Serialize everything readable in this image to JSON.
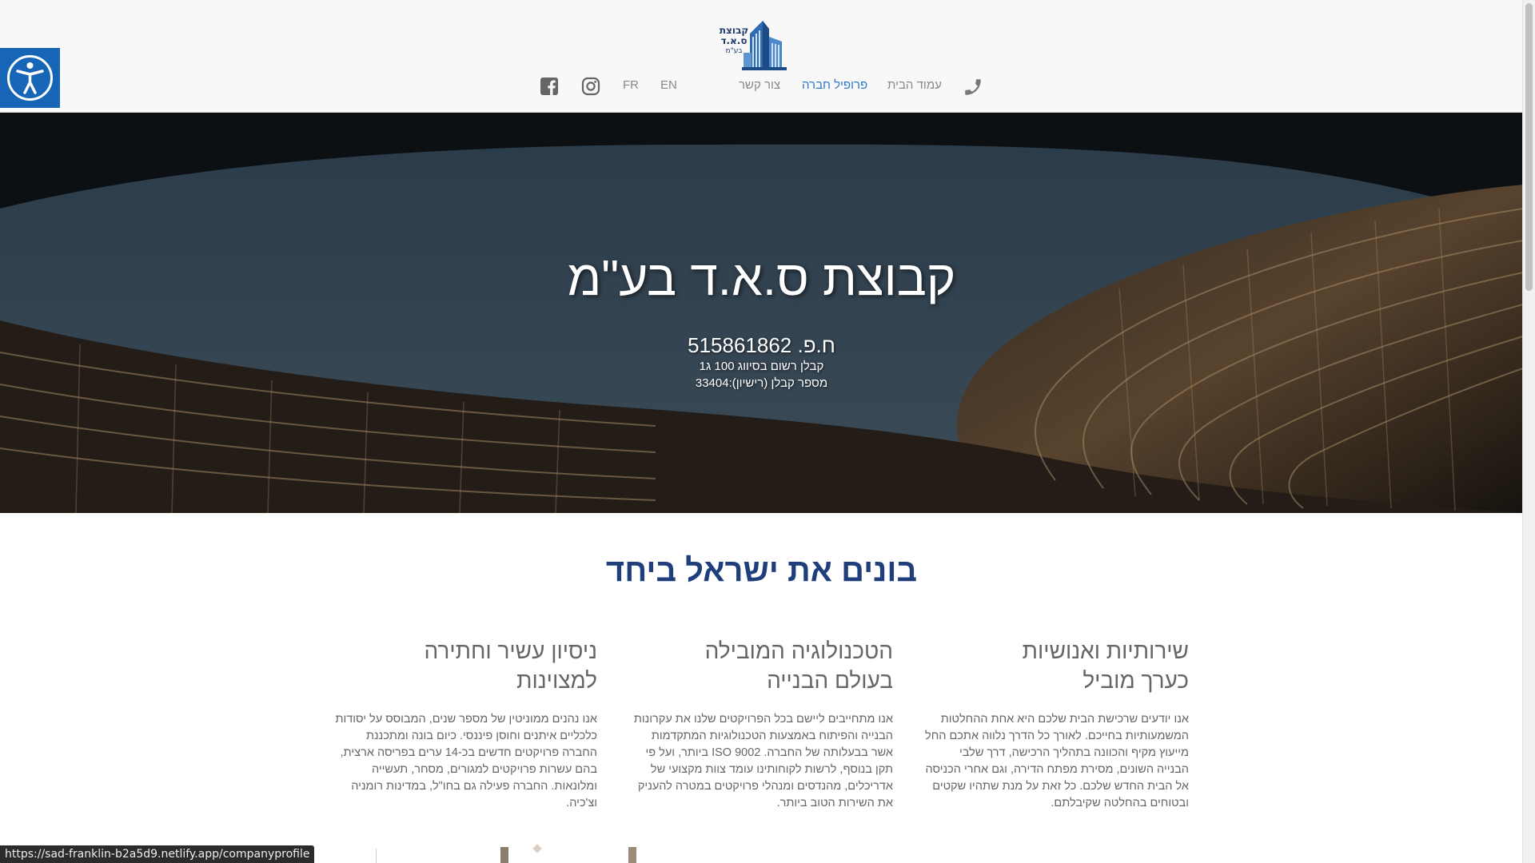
{
  "logo": {
    "text_lines": [
      "קבוצת",
      "ס.א.ד",
      "בע\"מ"
    ]
  },
  "nav": {
    "items": [
      {
        "label": "עמוד הבית",
        "active": false
      },
      {
        "label": "פרופיל חברה",
        "active": true
      },
      {
        "label": "צור קשר",
        "active": false
      }
    ],
    "languages": [
      "EN",
      "FR"
    ],
    "icons": [
      "phone-icon",
      "instagram-icon",
      "facebook-icon"
    ]
  },
  "accessibility": {
    "icon": "accessibility-icon",
    "color": "#1665b6"
  },
  "hero": {
    "title": "קבוצת ס.א.ד בע\"מ",
    "company_id": "ח.פ. 515861862",
    "contractor_class": "קבלן רשום בסיווג 100 ג1",
    "license": "מספר קבלן (רישיון):33404"
  },
  "section": {
    "title": "בונים את ישראל ביחד",
    "columns": [
      {
        "heading": "שירותיות ואנושיות\nכערך מוביל",
        "body": "אנו יודעים שרכישת הבית שלכם היא אחת ההחלטות המשמעותיות בחייכם. לאורך כל הדרך נלווה אתכם החל מייעוץ מקיף והכוונה בתהליך הרכישה, דרך שלבי הבנייה השונים, מסירת מפתח הדירה, וגם אחרי הכניסה אל הבית החדש שלכם. כל זאת על מנת שתהיו שקטים ובטוחים בהחלטה שקיבלתם."
      },
      {
        "heading": "הטכנולוגיה המובילה\nבעולם הבנייה",
        "body": "אנו מתחייבים ליישם בכל הפרויקטים שלנו את עקרונות הבנייה והפיתוח באמצעות הטכנולוגיות המתקדמות אשר בבעלותה של החברה. ISO 9002 ביותר, ועל פי תקן בנוסף, לרשות לקוחותינו עומד צוות מקצועי של אדריכלים, מהנדסים ומנהלי פרויקטים במטרה להעניק את השירות הטוב ביותר."
      },
      {
        "heading": "ניסיון עשיר וחתירה\nלמצוינות",
        "body": "אנו נהנים ממוניטין של מספר שנים, המבוסס על יסודות כלכליים איתנים וחוסן פיננסי. כיום בונה ומתכננת החברה פרויקטים חדשים בכ-14 ערים בפריסה ארצית, בהם עשרות פרויקטים למגורים, מסחר, תעשייה ומלונאות. החברה פעילה גם בחו\"ל, במדינות רומניה וצ'כיה."
      }
    ]
  },
  "status_bar": {
    "url": "https://sad-franklin-b2a5d9.netlify.app/companyprofile"
  }
}
